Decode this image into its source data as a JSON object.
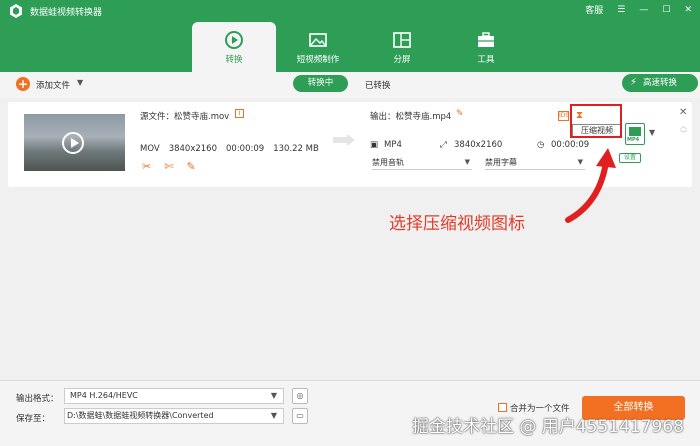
{
  "app": {
    "title": "数据蛙视频转换器"
  },
  "window": {
    "support": "客服",
    "menu_icon": "☰",
    "min_icon": "—",
    "max_icon": "☐",
    "close_icon": "✕"
  },
  "tabs": [
    {
      "label": "转换",
      "icon": "convert-icon",
      "active": true
    },
    {
      "label": "短视频制作",
      "icon": "image-icon"
    },
    {
      "label": "分屏",
      "icon": "split-icon"
    },
    {
      "label": "工具",
      "icon": "toolbox-icon"
    }
  ],
  "toolbar": {
    "add_label": "添加文件",
    "add_symbol": "+",
    "caret": "▼",
    "converting": "转换中",
    "converted": "已转换",
    "speed_label": "高速转换",
    "speed_symbol": "⚡"
  },
  "file": {
    "source_name": "源文件：松赞寺庙.mov",
    "info_symbol": "i",
    "format": "MOV",
    "resolution": "3840x2160",
    "duration": "00:00:09",
    "size": "130.22 MB",
    "tool_symbols": [
      "✂",
      "✄",
      "✎"
    ],
    "output_name": "输出：松赞寺庙.mp4",
    "edit_symbol": "✎",
    "out_format": "MP4",
    "out_resolution": "3840x2160",
    "out_duration": "00:00:09",
    "audio_track": "禁用音轨",
    "subtitle": "禁用字幕",
    "chip_label": "IDS",
    "compress_symbol": "⧗",
    "compress_label": "压缩视频",
    "badge_text": "MP4",
    "badge_caret": "▼",
    "settings_label": "设置",
    "close_symbol": "✕",
    "sort_up": "︿",
    "sort_down": "﹀",
    "res_symbol": "⤢",
    "clock_symbol": "◷",
    "film_symbol": "▣",
    "dd_caret": "▼"
  },
  "annotation": {
    "text": "选择压缩视频图标",
    "color": "#e23b2a"
  },
  "bottom": {
    "format_label": "输出格式：",
    "format_value": "MP4 H.264/HEVC",
    "save_label": "保存至：",
    "save_value": "D:\\数据蛙\\数据蛙视频转换器\\Converted",
    "caret": "▼",
    "format_btn_symbol": "◎",
    "folder_btn_symbol": "▭",
    "merge_label": "合并为一个文件",
    "convert_label": "全部转换"
  },
  "watermark": {
    "text": "掘金技术社区 @ 用户4551417968"
  },
  "colors": {
    "brand": "#2e9e57",
    "accent": "#f36f21",
    "highlight": "#e02020"
  }
}
